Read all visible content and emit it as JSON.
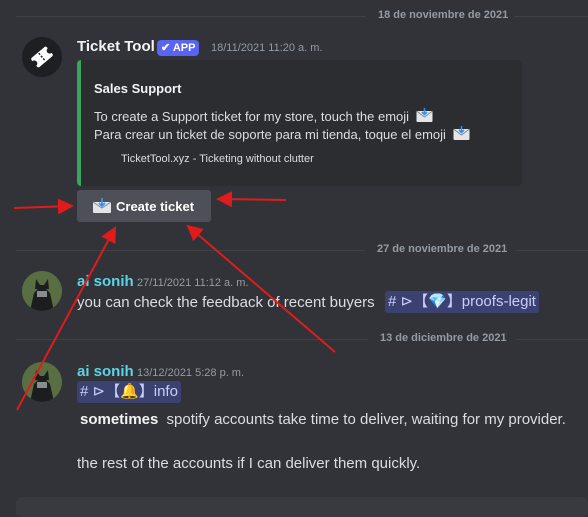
{
  "dividers": [
    "18 de noviembre de 2021",
    "27 de noviembre de 2021",
    "13 de diciembre de 2021"
  ],
  "messages": {
    "bot": {
      "name": "Ticket Tool",
      "badge": "✔ APP",
      "timestamp": "18/11/2021 11:20 a. m.",
      "embed": {
        "title": "Sales Support",
        "line1": "To create a Support ticket for my store, touch the emoji",
        "line2": "Para crear un ticket de soporte para mi tienda, toque el emoji",
        "footer": "TicketTool.xyz - Ticketing without clutter"
      },
      "button_label": "Create ticket"
    },
    "msg1": {
      "name": "ai sonih",
      "timestamp": "27/11/2021 11:12 a. m.",
      "text": "you can check the feedback of recent buyers",
      "channel": "# ⊳【💎】proofs-legit"
    },
    "msg2": {
      "name": "ai sonih",
      "timestamp": "13/12/2021 5:28 p. m.",
      "channel": "# ⊳【🔔】info",
      "bold_word": "sometimes",
      "text1": "spotify accounts take time to deliver, waiting for my provider.",
      "text2": "the rest of the accounts if I can deliver them quickly."
    }
  },
  "colors": {
    "background": "#313338",
    "username_cyan": "#5ad4e6",
    "annotation_arrows": "#e01b1b",
    "embed_accent": "#3ba55d"
  }
}
